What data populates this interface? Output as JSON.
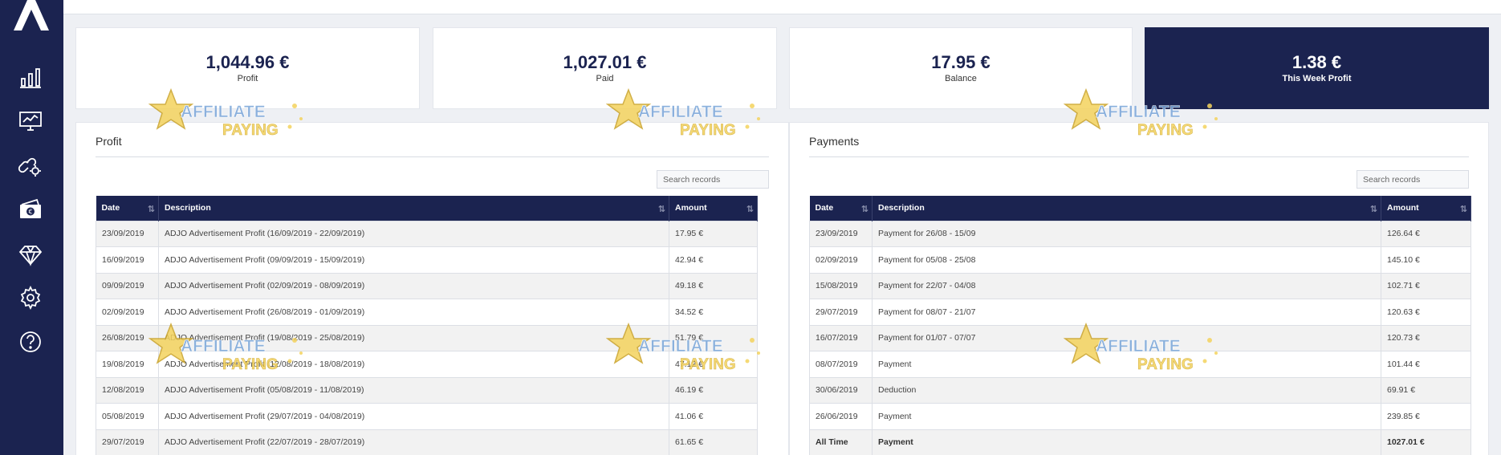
{
  "sidebar": {
    "brand_color": "#1b2350",
    "logo": "logo-chevron",
    "items": [
      {
        "icon": "bar-chart-icon"
      },
      {
        "icon": "monitor-chart-icon"
      },
      {
        "icon": "link-gear-icon"
      },
      {
        "icon": "euro-wallet-icon"
      },
      {
        "icon": "diamond-icon"
      },
      {
        "icon": "gear-icon"
      },
      {
        "icon": "help-icon"
      }
    ]
  },
  "stats": [
    {
      "value": "1,044.96 €",
      "label": "Profit"
    },
    {
      "value": "1,027.01 €",
      "label": "Paid"
    },
    {
      "value": "17.95 €",
      "label": "Balance"
    },
    {
      "value": "1.38 €",
      "label": "This Week Profit"
    }
  ],
  "profit": {
    "title": "Profit",
    "search_placeholder": "Search records",
    "columns": [
      "Date",
      "Description",
      "Amount"
    ],
    "rows": [
      [
        "23/09/2019",
        "ADJO Advertisement Profit (16/09/2019 - 22/09/2019)",
        "17.95 €"
      ],
      [
        "16/09/2019",
        "ADJO Advertisement Profit (09/09/2019 - 15/09/2019)",
        "42.94 €"
      ],
      [
        "09/09/2019",
        "ADJO Advertisement Profit (02/09/2019 - 08/09/2019)",
        "49.18 €"
      ],
      [
        "02/09/2019",
        "ADJO Advertisement Profit (26/08/2019 - 01/09/2019)",
        "34.52 €"
      ],
      [
        "26/08/2019",
        "ADJO Advertisement Profit (19/08/2019 - 25/08/2019)",
        "51.79 €"
      ],
      [
        "19/08/2019",
        "ADJO Advertisement Profit (12/08/2019 - 18/08/2019)",
        "47.12 €"
      ],
      [
        "12/08/2019",
        "ADJO Advertisement Profit (05/08/2019 - 11/08/2019)",
        "46.19 €"
      ],
      [
        "05/08/2019",
        "ADJO Advertisement Profit (29/07/2019 - 04/08/2019)",
        "41.06 €"
      ],
      [
        "29/07/2019",
        "ADJO Advertisement Profit (22/07/2019 - 28/07/2019)",
        "61.65 €"
      ]
    ]
  },
  "payments": {
    "title": "Payments",
    "search_placeholder": "Search records",
    "columns": [
      "Date",
      "Description",
      "Amount"
    ],
    "rows": [
      [
        "23/09/2019",
        "Payment for 26/08 - 15/09",
        "126.64 €"
      ],
      [
        "02/09/2019",
        "Payment for 05/08 - 25/08",
        "145.10 €"
      ],
      [
        "15/08/2019",
        "Payment for 22/07 - 04/08",
        "102.71 €"
      ],
      [
        "29/07/2019",
        "Payment for 08/07 - 21/07",
        "120.63 €"
      ],
      [
        "16/07/2019",
        "Payment for 01/07 - 07/07",
        "120.73 €"
      ],
      [
        "08/07/2019",
        "Payment",
        "101.44 €"
      ],
      [
        "30/06/2019",
        "Deduction",
        "69.91 €"
      ],
      [
        "26/06/2019",
        "Payment",
        "239.85 €"
      ],
      [
        "All Time",
        "Payment",
        "1027.01 €"
      ]
    ]
  },
  "watermark": {
    "line1": "AFFILIATE",
    "line2": "PAYING"
  }
}
